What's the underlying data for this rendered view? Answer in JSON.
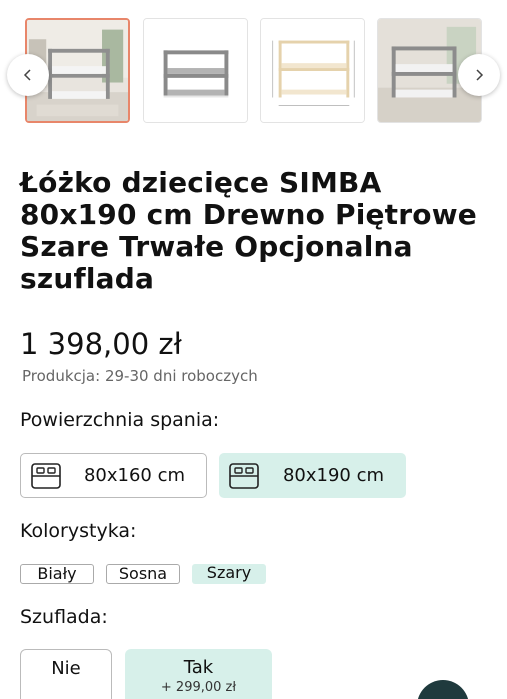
{
  "gallery": {
    "thumbnails": [
      {
        "alt": "bed-in-room-photo",
        "active": true
      },
      {
        "alt": "bed-grey-render",
        "active": false
      },
      {
        "alt": "bed-dimensions-drawing",
        "active": false
      },
      {
        "alt": "bed-in-room-photo-2",
        "active": false
      }
    ],
    "prev_icon": "chevron-left-icon",
    "next_icon": "chevron-right-icon"
  },
  "product": {
    "title": "Łóżko dziecięce SIMBA 80x190 cm Drewno Piętrowe Szare Trwałe Opcjonalna szuflada",
    "price": "1 398,00 zł",
    "production": "Produkcja: 29-30 dni roboczych"
  },
  "sleeping_area": {
    "label": "Powierzchnia spania:",
    "options": [
      {
        "label": "80x160 cm",
        "selected": false,
        "icon": "bed-icon"
      },
      {
        "label": "80x190 cm",
        "selected": true,
        "icon": "bed-icon"
      }
    ]
  },
  "colors": {
    "label": "Kolorystyka:",
    "options": [
      {
        "label": "Biały",
        "selected": false
      },
      {
        "label": "Sosna",
        "selected": false
      },
      {
        "label": "Szary",
        "selected": true
      }
    ]
  },
  "drawer": {
    "label": "Szuflada:",
    "options": [
      {
        "label": "Nie",
        "extra": "",
        "selected": false
      },
      {
        "label": "Tak",
        "extra": "+ 299,00 zł",
        "selected": true
      }
    ]
  },
  "theme": {
    "selected_bg": "#d7f0ea",
    "active_thumb_border": "#e8866a",
    "fab_color": "#1f3a3d"
  }
}
